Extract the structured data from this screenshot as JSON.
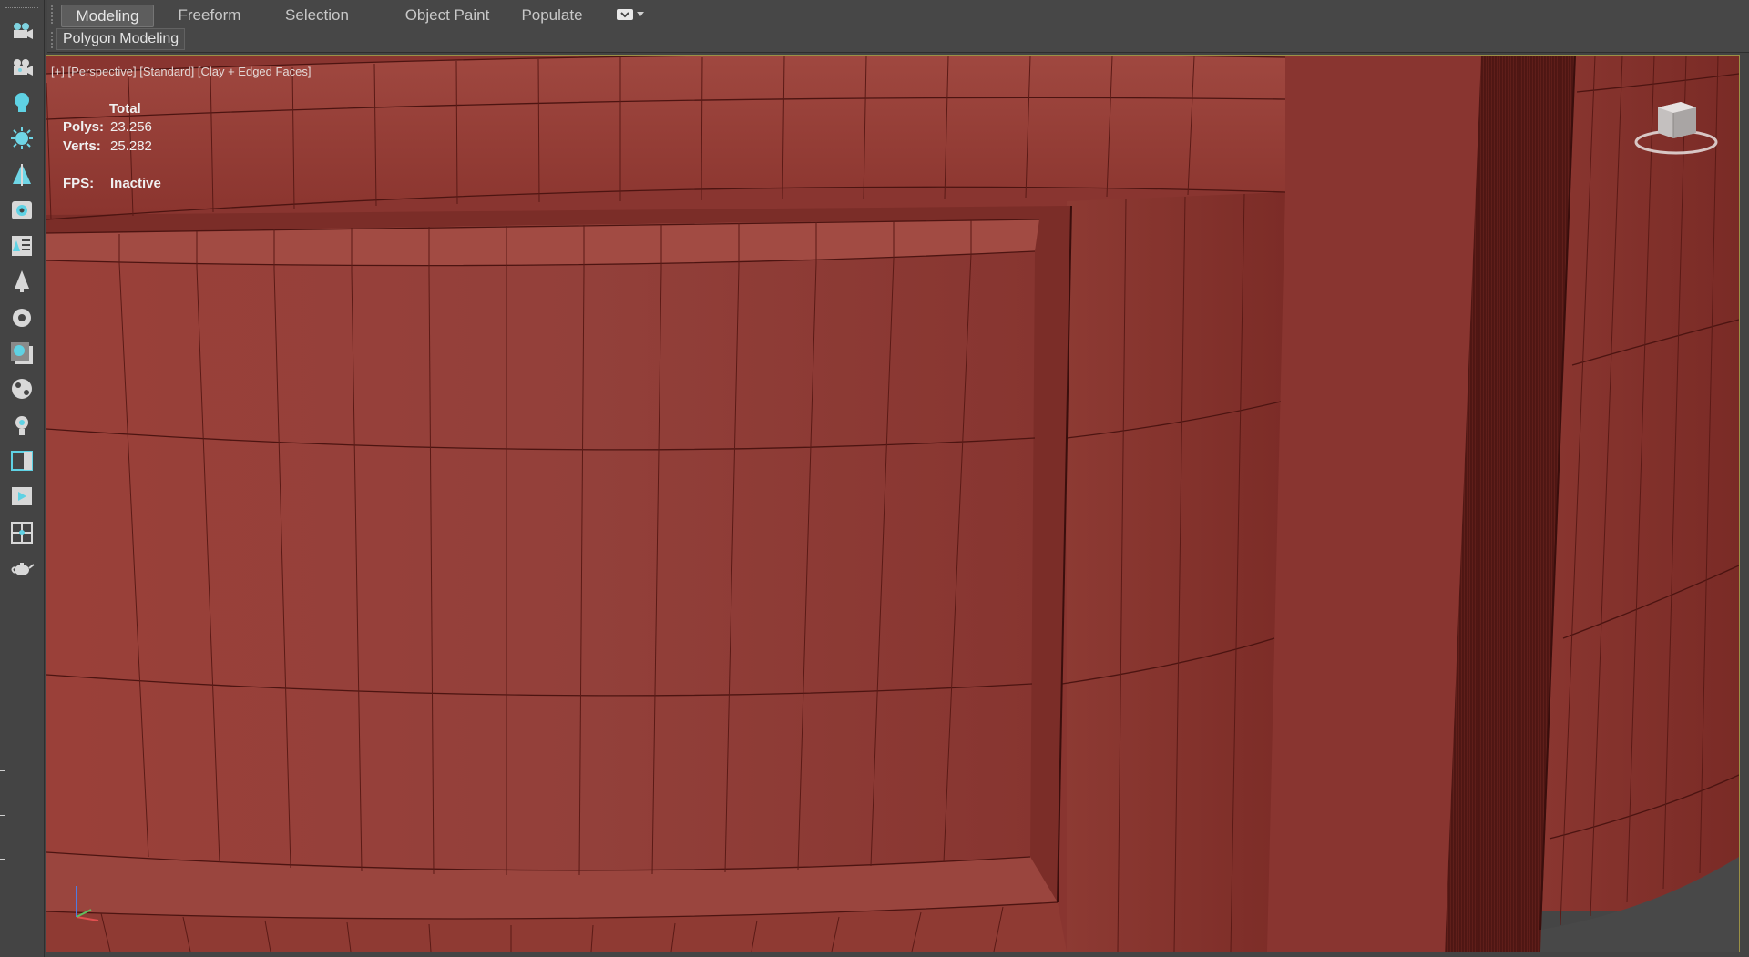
{
  "ribbon": {
    "tabs": [
      {
        "label": "Modeling",
        "active": true
      },
      {
        "label": "Freeform",
        "active": false
      },
      {
        "label": "Selection",
        "active": false
      },
      {
        "label": "Object Paint",
        "active": false
      },
      {
        "label": "Populate",
        "active": false
      }
    ],
    "options_icon": "ribbon-options-icon",
    "panel": {
      "label": "Polygon Modeling"
    }
  },
  "left_toolbar": {
    "icons": [
      "camera-icon",
      "camera-icon",
      "light-bulb-icon",
      "sun-icon",
      "tree-icon",
      "rotate-camera-icon",
      "list-panel-icon",
      "pine-tree-icon",
      "gear-icon",
      "viewport-shaded-icon",
      "render-sphere-icon",
      "light-icon",
      "window-icon",
      "render-frame-icon",
      "snap-grid-icon",
      "teapot-icon"
    ]
  },
  "viewport": {
    "label": {
      "plus": "[+]",
      "view": "[Perspective]",
      "shading_preset": "[Standard]",
      "mode": "[Clay + Edged Faces]"
    },
    "stats": {
      "header": "Total",
      "polys_label": "Polys:",
      "polys_value": "23.256",
      "verts_label": "Verts:",
      "verts_value": "25.282",
      "fps_label": "FPS:",
      "fps_value": "Inactive"
    },
    "mesh_color": "#8e3731",
    "border_color": "#9b9146"
  }
}
